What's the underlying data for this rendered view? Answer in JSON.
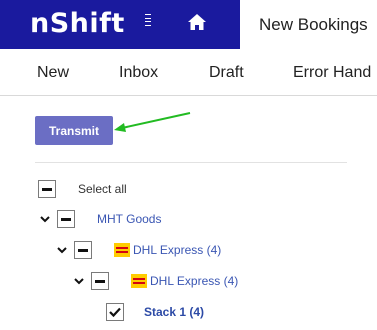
{
  "header": {
    "logo_text": "nShift",
    "active_tab": "New Bookings"
  },
  "nav": {
    "items": [
      "New",
      "Inbox",
      "Draft",
      "Error Hand"
    ]
  },
  "toolbar": {
    "transmit_label": "Transmit"
  },
  "tree": {
    "select_all": "Select all",
    "group": "MHT Goods",
    "carrier": "DHL Express (4)",
    "sub_carrier": "DHL Express (4)",
    "stack": "Stack 1 (4)"
  },
  "colors": {
    "brand": "#1a1a9e",
    "button": "#6b6ec4",
    "link": "#3a56b3",
    "arrow": "#22bb22",
    "dhl_yellow": "#ffcc00",
    "dhl_red": "#d40511"
  }
}
